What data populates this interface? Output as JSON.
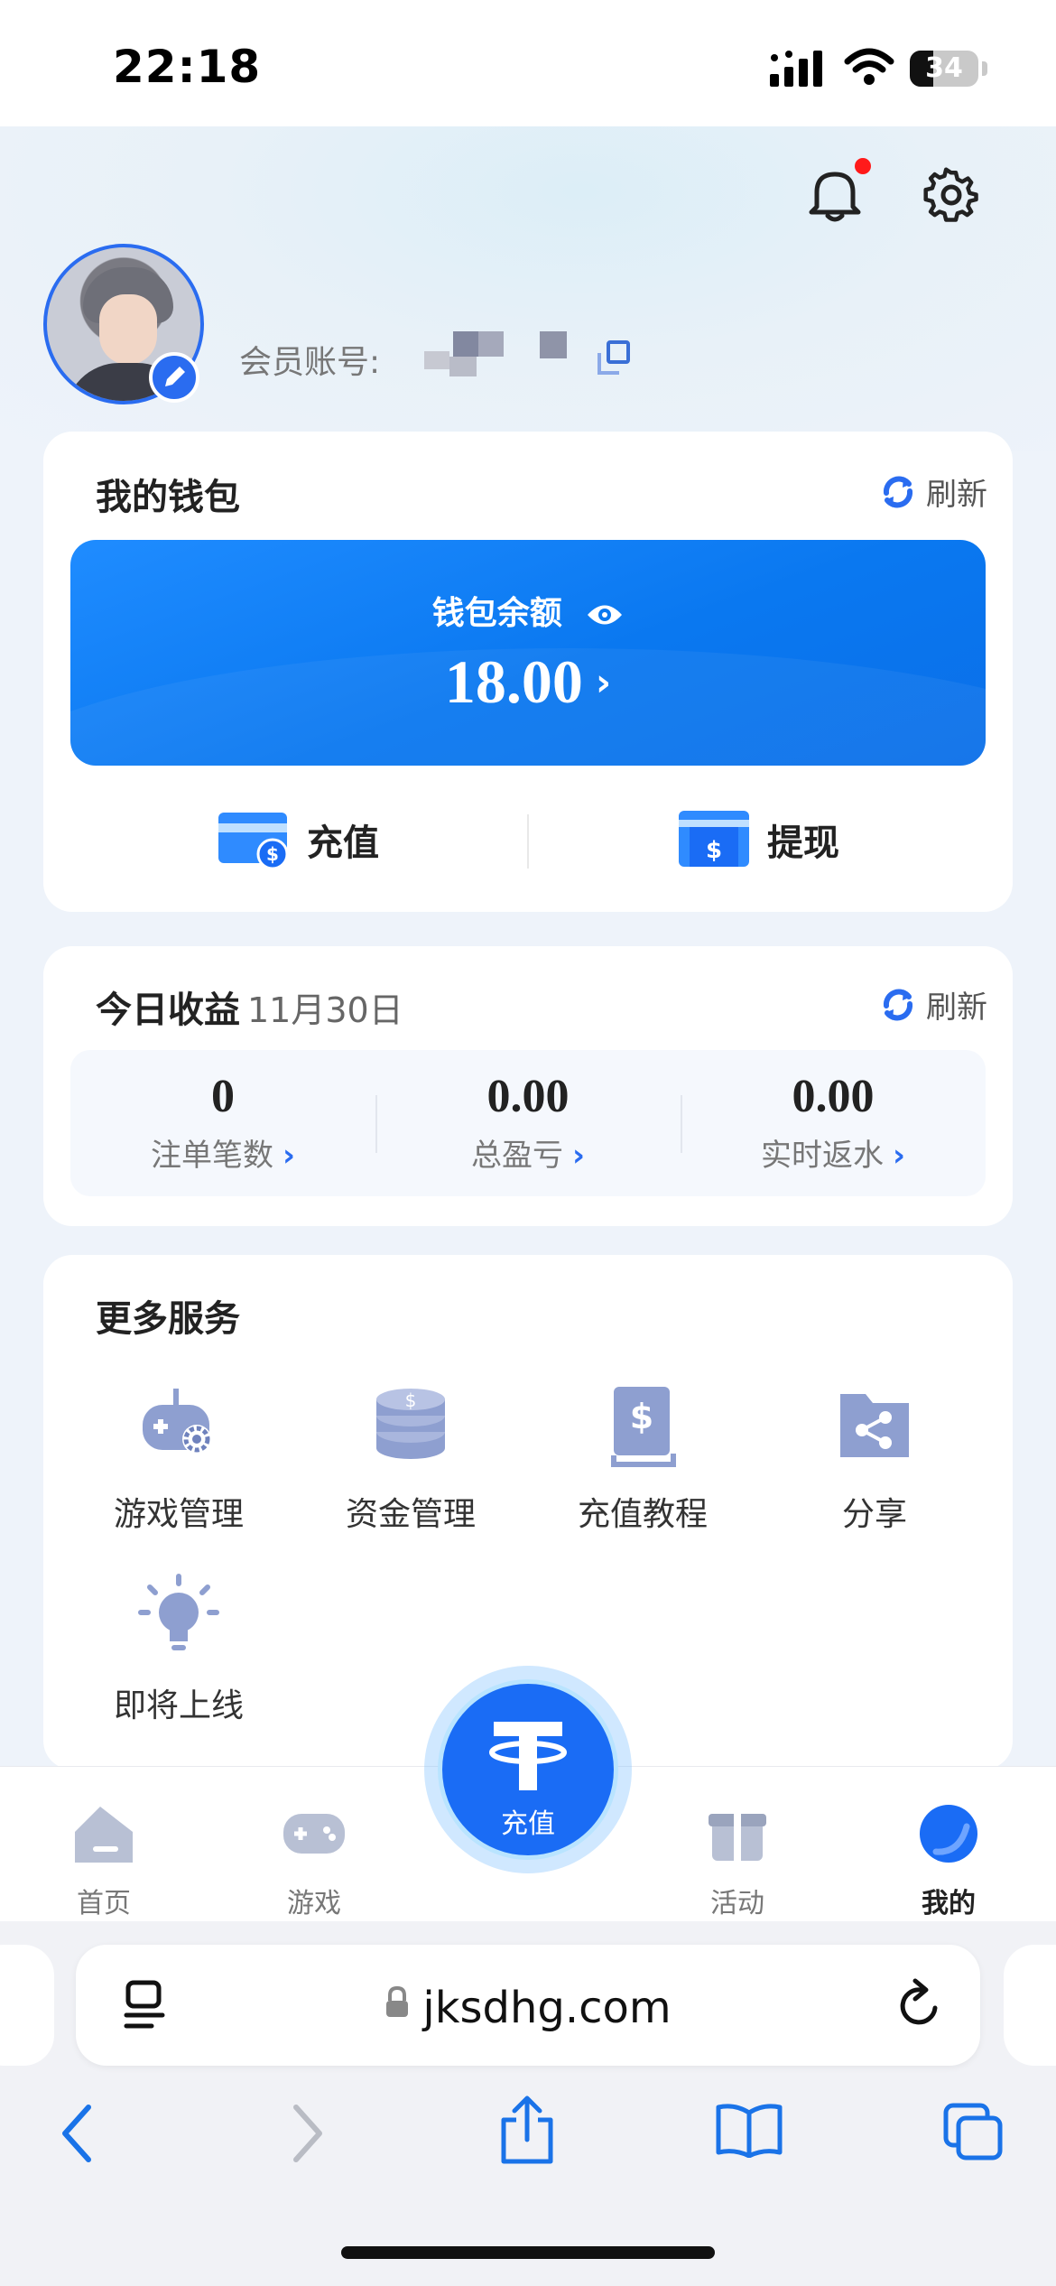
{
  "status_bar": {
    "time": "22:18",
    "battery": "34"
  },
  "profile": {
    "account_label": "会员账号:"
  },
  "wallet": {
    "title": "我的钱包",
    "refresh": "刷新",
    "balance_label": "钱包余额",
    "balance": "18.00",
    "deposit": "充值",
    "withdraw": "提现"
  },
  "income": {
    "title": "今日收益",
    "date": "11月30日",
    "refresh": "刷新",
    "stats": [
      {
        "value": "0",
        "label": "注单笔数"
      },
      {
        "value": "0.00",
        "label": "总盈亏"
      },
      {
        "value": "0.00",
        "label": "实时返水"
      }
    ]
  },
  "services": {
    "title": "更多服务",
    "items": [
      {
        "label": "游戏管理",
        "icon": "gamepad-gear-icon"
      },
      {
        "label": "资金管理",
        "icon": "coin-stack-icon"
      },
      {
        "label": "充值教程",
        "icon": "book-dollar-icon"
      },
      {
        "label": "分享",
        "icon": "share-folder-icon"
      },
      {
        "label": "即将上线",
        "icon": "lightbulb-icon"
      }
    ]
  },
  "tabbar": {
    "items": [
      {
        "label": "首页",
        "icon": "home-icon"
      },
      {
        "label": "游戏",
        "icon": "gamepad-icon"
      },
      {
        "label": "活动",
        "icon": "gift-icon"
      },
      {
        "label": "我的",
        "icon": "profile-icon"
      }
    ],
    "fab_label": "充值",
    "active": "我的"
  },
  "browser": {
    "url": "jksdhg.com"
  },
  "colors": {
    "accent": "#1a6cf5",
    "wallet_gradient": "#0a78f0",
    "icon_muted": "#8e9fd0",
    "notification_dot": "#ff1a1a"
  }
}
